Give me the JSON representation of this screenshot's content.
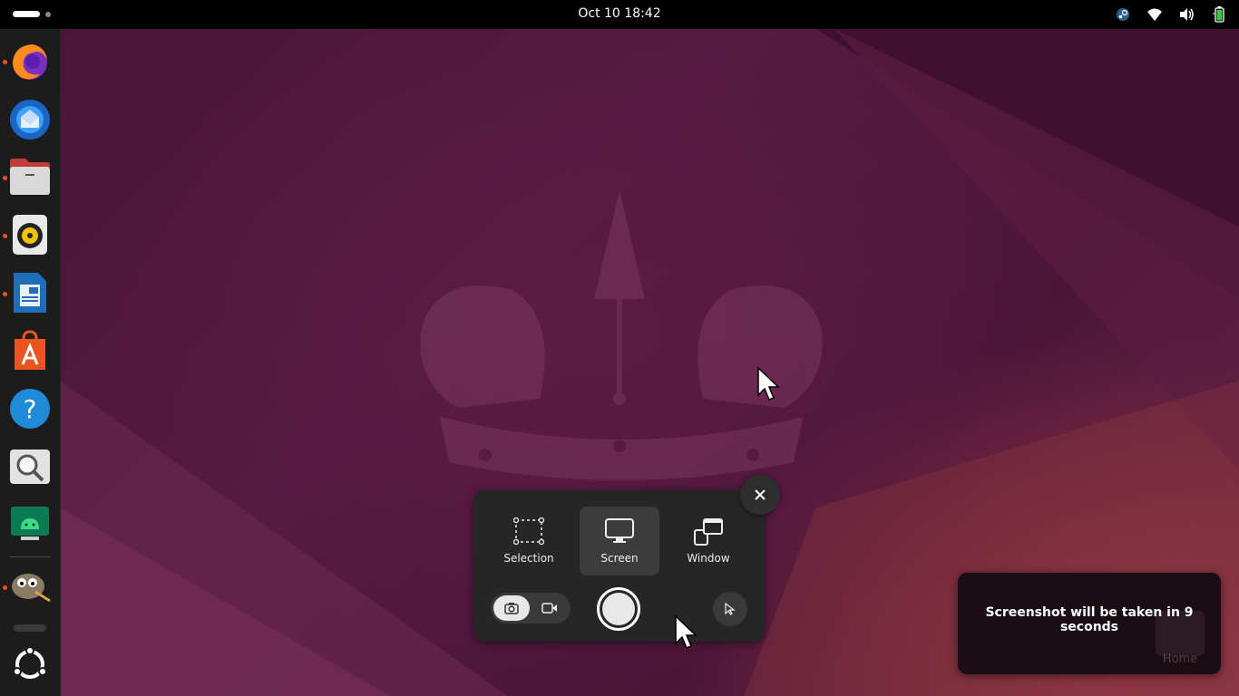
{
  "topbar": {
    "clock": "Oct 10  18:42",
    "tray_icons": [
      "steam-icon",
      "wifi-icon",
      "volume-icon",
      "battery-icon"
    ]
  },
  "dock": {
    "apps": [
      {
        "name": "firefox",
        "running": true
      },
      {
        "name": "thunderbird",
        "running": false
      },
      {
        "name": "files",
        "running": true
      },
      {
        "name": "rhythmbox",
        "running": true
      },
      {
        "name": "libreoffice-writer",
        "running": true
      },
      {
        "name": "app-center",
        "running": false
      },
      {
        "name": "help",
        "running": false
      },
      {
        "name": "image-viewer",
        "running": false
      },
      {
        "name": "android-studio",
        "running": false
      },
      {
        "name": "gimp",
        "running": true
      }
    ],
    "show_apps": "ubuntu-logo-icon"
  },
  "screenshot_panel": {
    "modes": [
      {
        "label": "Selection",
        "active": false
      },
      {
        "label": "Screen",
        "active": true
      },
      {
        "label": "Window",
        "active": false
      }
    ],
    "capture_type": "screenshot",
    "show_pointer": false
  },
  "notification": {
    "message": "Screenshot will be taken in 9 seconds",
    "ghost_label": "Home"
  },
  "colors": {
    "accent": "#e95420",
    "panel_bg": "#262626",
    "topbar_bg": "#000000"
  }
}
